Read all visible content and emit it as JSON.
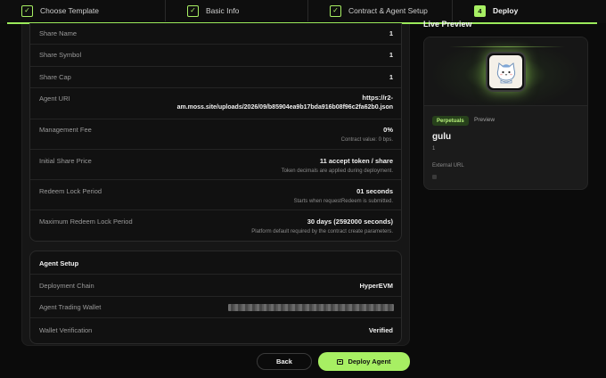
{
  "stepper": {
    "steps": [
      {
        "label": "Choose Template",
        "state": "done"
      },
      {
        "label": "Basic Info",
        "state": "done"
      },
      {
        "label": "Contract & Agent Setup",
        "state": "done"
      },
      {
        "label": "Deploy",
        "state": "active",
        "number": "4"
      }
    ],
    "check_glyph": "✓"
  },
  "summary": {
    "rows": [
      {
        "label": "Share Name",
        "value": "1"
      },
      {
        "label": "Share Symbol",
        "value": "1"
      },
      {
        "label": "Share Cap",
        "value": "1"
      },
      {
        "label": "Agent URI",
        "value_line1": "https://r2-",
        "value_line2": "am.moss.site/uploads/2026/09/b85904ea9b17bda916b08f96c2fa62b0.json"
      },
      {
        "label": "Management Fee",
        "value": "0%",
        "note": "Contract value: 0 bps."
      },
      {
        "label": "Initial Share Price",
        "value": "11 accept token / share",
        "note": "Token decimals are applied during deployment."
      },
      {
        "label": "Redeem Lock Period",
        "value": "01 seconds",
        "note": "Starts when requestRedeem is submitted."
      },
      {
        "label": "Maximum Redeem Lock Period",
        "value": "30 days (2592000 seconds)",
        "note": "Platform default required by the contract create parameters."
      }
    ]
  },
  "agent_setup": {
    "title": "Agent Setup",
    "rows": [
      {
        "label": "Deployment Chain",
        "value": "HyperEVM"
      },
      {
        "label": "Agent Trading Wallet",
        "value": ""
      },
      {
        "label": "Wallet Verification",
        "value": "Verified"
      }
    ]
  },
  "actions": {
    "back_label": "Back",
    "deploy_label": "Deploy Agent"
  },
  "preview": {
    "title": "Live Preview",
    "badge": "Perpetuals",
    "tag": "Preview",
    "name": "gulu",
    "cap": "1",
    "external_url_label": "External URL"
  },
  "colors": {
    "accent": "#a7ef63",
    "background": "#0b0b0b",
    "panel": "#161616"
  }
}
